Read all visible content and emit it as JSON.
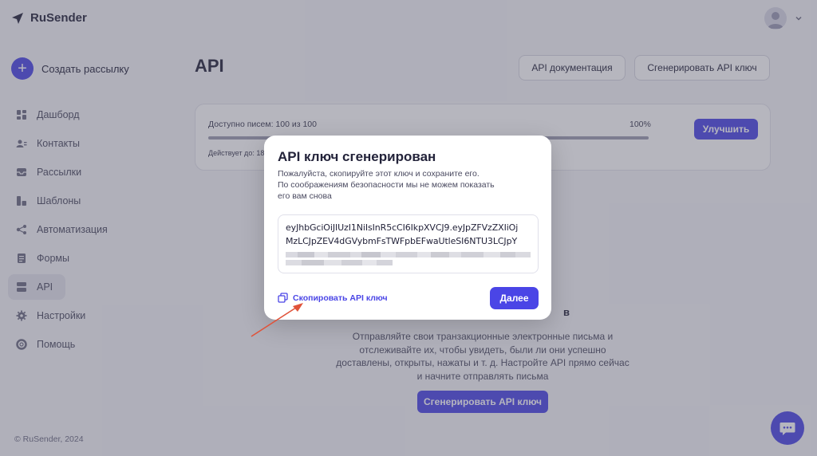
{
  "app": {
    "logo_text": "RuSender",
    "footer": "© RuSender, 2024"
  },
  "sidebar": {
    "create_label": "Создать рассылку",
    "items": [
      {
        "label": "Дашборд",
        "icon": "dashboard-icon"
      },
      {
        "label": "Контакты",
        "icon": "contacts-icon"
      },
      {
        "label": "Рассылки",
        "icon": "mailings-icon"
      },
      {
        "label": "Шаблоны",
        "icon": "templates-icon"
      },
      {
        "label": "Автоматизация",
        "icon": "automation-icon"
      },
      {
        "label": "Формы",
        "icon": "forms-icon"
      },
      {
        "label": "API",
        "icon": "api-icon",
        "active": true
      },
      {
        "label": "Настройки",
        "icon": "gear-icon"
      },
      {
        "label": "Помощь",
        "icon": "help-icon"
      }
    ]
  },
  "header": {
    "page_title": "API",
    "docs_button": "API документация",
    "generate_button": "Сгенерировать API ключ"
  },
  "usage": {
    "available_label": "Доступно писем: 100 из 100",
    "percent_label": "100%",
    "fill_fraction": 1.0,
    "valid_label": "Действует до: 18",
    "upgrade_button": "Улучшить"
  },
  "empty_state": {
    "title": "в",
    "text": "Отправляйте свои транзакционные электронные письма и отслеживайте их, чтобы увидеть, были ли они успешно доставлены, открыты, нажаты и т. д. Настройте API прямо сейчас и начните отправлять письма",
    "generate_button": "Сгенерировать API ключ"
  },
  "modal": {
    "title": "API ключ сгенерирован",
    "description_line1": "Пожалуйста, скопируйте этот ключ и сохраните его.",
    "description_line2": "По соображениям безопасности мы не можем показать",
    "description_line3": "его вам снова",
    "key_line1": "eyJhbGciOiJIUzI1NiIsInR5cCI6IkpXVCJ9.eyJpZFVzZXIiOj",
    "key_line2": "MzLCJpZEV4dGVybmFsTWFpbEFwaUtleSI6NTU3LCJpY",
    "copy_link": "Скопировать API ключ",
    "next_button": "Далее"
  },
  "colors": {
    "accent": "#4a45e6",
    "arrow": "#e0533a",
    "overlay": "rgba(80,80,100,0.42)"
  }
}
